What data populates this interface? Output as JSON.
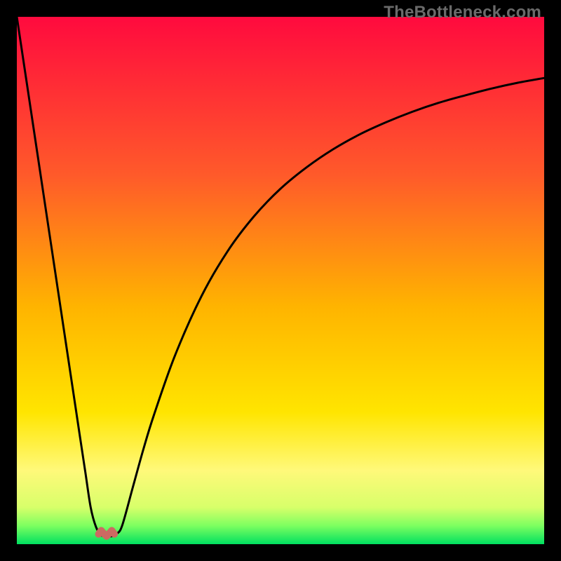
{
  "watermark": "TheBottleneck.com",
  "chart_data": {
    "type": "line",
    "title": "",
    "xlabel": "",
    "ylabel": "",
    "xlim": [
      0,
      100
    ],
    "ylim": [
      0,
      100
    ],
    "grid": false,
    "legend": false,
    "gradient_stops": [
      {
        "pos": 0.0,
        "color": "#ff0a3e"
      },
      {
        "pos": 0.3,
        "color": "#ff5a2a"
      },
      {
        "pos": 0.55,
        "color": "#ffb400"
      },
      {
        "pos": 0.75,
        "color": "#ffe500"
      },
      {
        "pos": 0.86,
        "color": "#fff97a"
      },
      {
        "pos": 0.93,
        "color": "#d8ff6a"
      },
      {
        "pos": 0.965,
        "color": "#7dff60"
      },
      {
        "pos": 1.0,
        "color": "#00e060"
      }
    ],
    "series": [
      {
        "name": "bottleneck-curve",
        "color": "#000000",
        "x": [
          0,
          2,
          4,
          6,
          8,
          10,
          12,
          13,
          14,
          15,
          16,
          17,
          18,
          19,
          20,
          22,
          24,
          26,
          30,
          35,
          40,
          45,
          50,
          55,
          60,
          65,
          70,
          75,
          80,
          85,
          90,
          95,
          100
        ],
        "y": [
          100,
          86.7,
          73.4,
          60.1,
          46.8,
          33.5,
          20.2,
          13.6,
          7.0,
          3.3,
          1.7,
          1.5,
          1.5,
          2.0,
          3.6,
          10.8,
          18.0,
          24.5,
          35.8,
          47.0,
          55.6,
          62.2,
          67.4,
          71.5,
          74.9,
          77.7,
          80.0,
          82.0,
          83.7,
          85.1,
          86.4,
          87.5,
          88.4
        ]
      }
    ],
    "marker": {
      "name": "loop-marker",
      "color": "#cc6a62",
      "x": [
        15.5,
        16.0,
        16.5,
        17.0,
        17.5,
        18.0,
        18.5
      ],
      "y": [
        1.9,
        2.6,
        2.0,
        1.5,
        2.0,
        2.6,
        1.9
      ]
    }
  }
}
